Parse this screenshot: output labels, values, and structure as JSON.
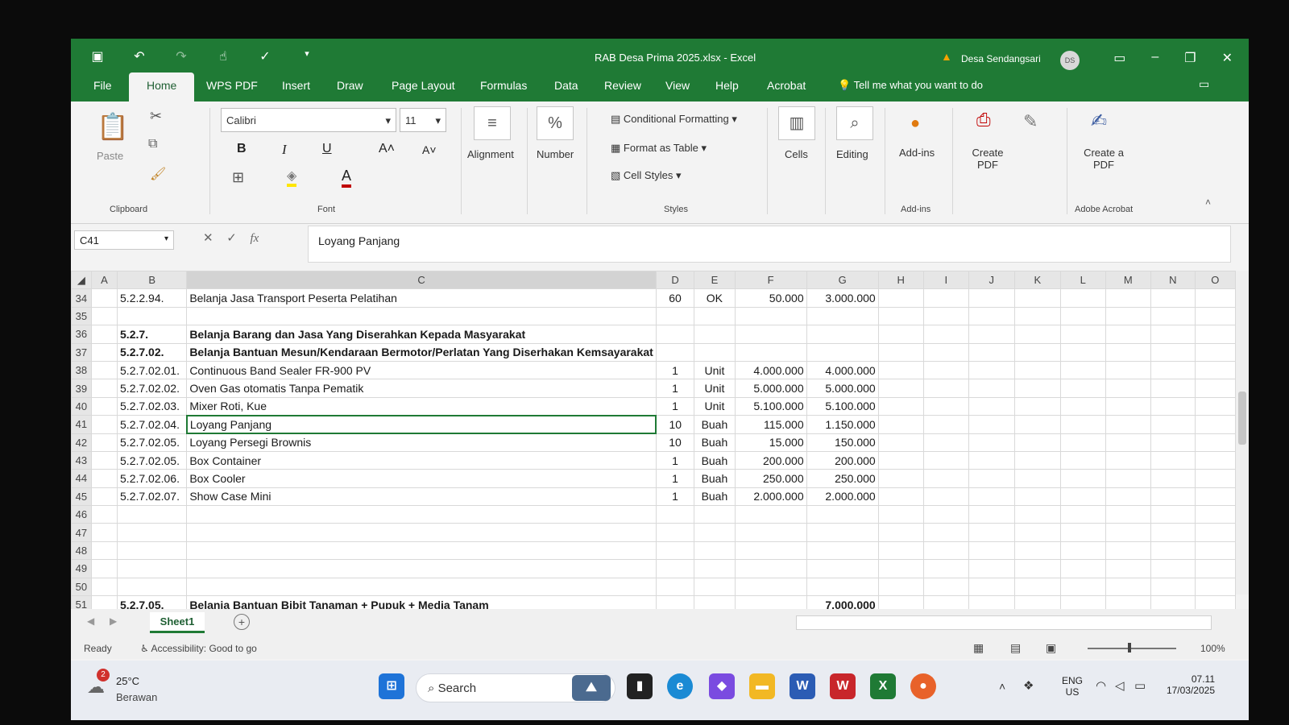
{
  "window": {
    "title": "RAB Desa Prima 2025.xlsx  -  Excel",
    "user": "Desa Sendangsari",
    "user_initials": "DS"
  },
  "menu": [
    "File",
    "Home",
    "WPS PDF",
    "Insert",
    "Draw",
    "Page Layout",
    "Formulas",
    "Data",
    "Review",
    "View",
    "Help",
    "Acrobat"
  ],
  "tell_me": "Tell me what you want to do",
  "ribbon": {
    "paste": "Paste",
    "clipboard": "Clipboard",
    "font_name": "Calibri",
    "font_size": "11",
    "font": "Font",
    "alignment": "Alignment",
    "number": "Number",
    "conditional_formatting": "Conditional Formatting",
    "format_as_table": "Format as Table",
    "cell_styles": "Cell Styles",
    "styles": "Styles",
    "cells": "Cells",
    "editing": "Editing",
    "addins": "Add-ins",
    "addins_group": "Add-ins",
    "create_pdf": "Create PDF",
    "create_a_pdf": "Create a PDF",
    "adobe_acrobat": "Adobe Acrobat"
  },
  "formula_bar": {
    "name_box": "C41",
    "formula": "Loyang Panjang"
  },
  "columns": [
    "A",
    "B",
    "C",
    "D",
    "E",
    "F",
    "G",
    "H",
    "I",
    "J",
    "K",
    "L",
    "M",
    "N",
    "O"
  ],
  "rows": [
    {
      "n": "34",
      "B": "5.2.2.94.",
      "C": "Belanja Jasa Transport Peserta Pelatihan",
      "D": "60",
      "E": "OK",
      "F": "50.000",
      "G": "3.000.000",
      "bold": false
    },
    {
      "n": "35",
      "B": "",
      "C": "",
      "D": "",
      "E": "",
      "F": "",
      "G": "",
      "bold": false
    },
    {
      "n": "36",
      "B": "5.2.7.",
      "C": "Belanja Barang dan Jasa Yang Diserahkan Kepada Masyarakat",
      "D": "",
      "E": "",
      "F": "",
      "G": "",
      "bold": true
    },
    {
      "n": "37",
      "B": "5.2.7.02.",
      "C": "Belanja Bantuan Mesun/Kendaraan Bermotor/Perlatan Yang Diserhakan Kemsayarakat",
      "D": "",
      "E": "",
      "F": "",
      "G": "",
      "bold": true
    },
    {
      "n": "38",
      "B": "5.2.7.02.01.",
      "C": "Continuous Band Sealer FR-900 PV",
      "D": "1",
      "E": "Unit",
      "F": "4.000.000",
      "G": "4.000.000",
      "bold": false
    },
    {
      "n": "39",
      "B": "5.2.7.02.02.",
      "C": "Oven Gas otomatis Tanpa Pematik",
      "D": "1",
      "E": "Unit",
      "F": "5.000.000",
      "G": "5.000.000",
      "bold": false
    },
    {
      "n": "40",
      "B": "5.2.7.02.03.",
      "C": "Mixer Roti, Kue",
      "D": "1",
      "E": "Unit",
      "F": "5.100.000",
      "G": "5.100.000",
      "bold": false
    },
    {
      "n": "41",
      "B": "5.2.7.02.04.",
      "C": "Loyang Panjang",
      "D": "10",
      "E": "Buah",
      "F": "115.000",
      "G": "1.150.000",
      "bold": false
    },
    {
      "n": "42",
      "B": "5.2.7.02.05.",
      "C": "Loyang Persegi Brownis",
      "D": "10",
      "E": "Buah",
      "F": "15.000",
      "G": "150.000",
      "bold": false
    },
    {
      "n": "43",
      "B": "5.2.7.02.05.",
      "C": "Box Container",
      "D": "1",
      "E": "Buah",
      "F": "200.000",
      "G": "200.000",
      "bold": false
    },
    {
      "n": "44",
      "B": "5.2.7.02.06.",
      "C": "Box Cooler",
      "D": "1",
      "E": "Buah",
      "F": "250.000",
      "G": "250.000",
      "bold": false
    },
    {
      "n": "45",
      "B": "5.2.7.02.07.",
      "C": "Show Case Mini",
      "D": "1",
      "E": "Buah",
      "F": "2.000.000",
      "G": "2.000.000",
      "bold": false
    },
    {
      "n": "46",
      "B": "",
      "C": "",
      "D": "",
      "E": "",
      "F": "",
      "G": "",
      "bold": false
    },
    {
      "n": "47",
      "B": "",
      "C": "",
      "D": "",
      "E": "",
      "F": "",
      "G": "",
      "bold": false
    },
    {
      "n": "48",
      "B": "",
      "C": "",
      "D": "",
      "E": "",
      "F": "",
      "G": "",
      "bold": false
    },
    {
      "n": "49",
      "B": "",
      "C": "",
      "D": "",
      "E": "",
      "F": "",
      "G": "",
      "bold": false
    },
    {
      "n": "50",
      "B": "",
      "C": "",
      "D": "",
      "E": "",
      "F": "",
      "G": "",
      "bold": false
    },
    {
      "n": "51",
      "B": "5.2.7.05.",
      "C": "Belanja Bantuan Bibit Tanaman + Pupuk + Media Tanam",
      "D": "",
      "E": "",
      "F": "",
      "G": "7.000.000",
      "bold": true
    }
  ],
  "sheet_tab": "Sheet1",
  "status": {
    "ready": "Ready",
    "accessibility": "Accessibility: Good to go",
    "zoom": "100%"
  },
  "taskbar": {
    "temp": "25°C",
    "weather": "Berawan",
    "weather_badge": "2",
    "search": "Search",
    "lang1": "ENG",
    "lang2": "US",
    "time": "07.11",
    "date": "17/03/2025"
  },
  "colors": {
    "excel_green": "#1f7a35",
    "selected_green": "#1f5f33"
  }
}
